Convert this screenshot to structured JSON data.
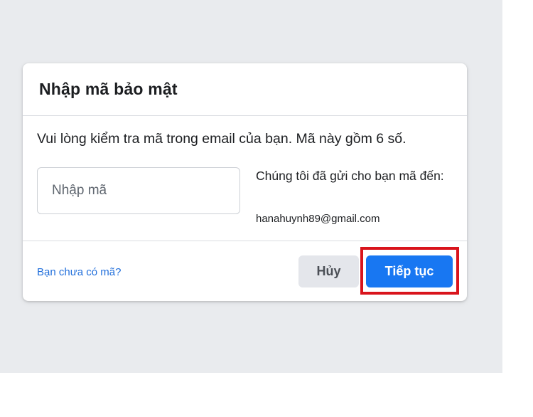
{
  "dialog": {
    "title": "Nhập mã bảo mật",
    "instruction": "Vui lòng kiểm tra mã trong email của bạn. Mã này gồm 6 số.",
    "code_input": {
      "placeholder": "Nhập mã",
      "value": ""
    },
    "sent_to_label": "Chúng tôi đã gửi cho bạn mã đến:",
    "email": "hanahuynh89@gmail.com"
  },
  "footer": {
    "no_code_link": "Bạn chưa có mã?",
    "cancel_label": "Hủy",
    "continue_label": "Tiếp tục"
  },
  "colors": {
    "primary": "#1877f2",
    "link": "#216fdb",
    "highlight": "#d9141c",
    "backdrop": "#e9ebee"
  }
}
